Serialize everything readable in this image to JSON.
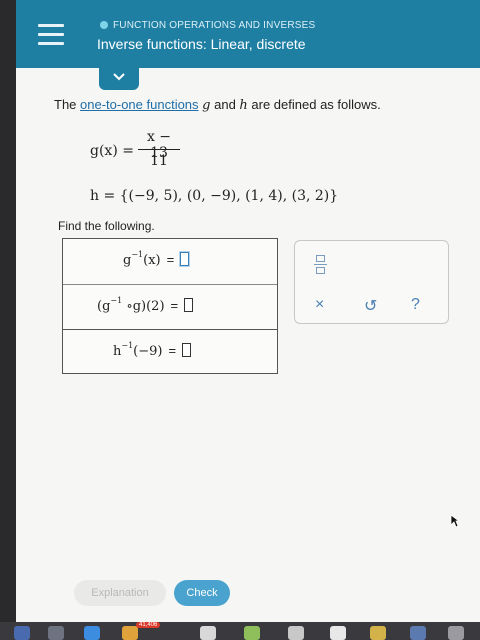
{
  "header": {
    "topic": "FUNCTION OPERATIONS AND INVERSES",
    "title": "Inverse functions: Linear, discrete"
  },
  "prompt": {
    "before": "The ",
    "link": "one-to-one functions",
    "var_g": "g",
    "middle": " and ",
    "var_h": "h",
    "after": " are defined as follows."
  },
  "g_def": {
    "lhs": "g(x) =",
    "numerator": "x − 13",
    "denominator": "11"
  },
  "h_def": "h = {(−9, 5), (0, −9), (1, 4), (3, 2)}",
  "find_label": "Find the following.",
  "answers": [
    {
      "fn": "g",
      "sup": "−1",
      "arg": "(x)",
      "eq": "="
    },
    {
      "open": "(g",
      "sup": "−1",
      "rest": " ∘g)(2)",
      "eq": "="
    },
    {
      "fn": "h",
      "sup": "−1",
      "arg": "(−9)",
      "eq": "="
    }
  ],
  "tools": {
    "clear": "×",
    "undo": "↺",
    "help": "?"
  },
  "buttons": {
    "explanation": "Explanation",
    "check": "Check"
  },
  "dock": {
    "badge": "41,406"
  },
  "colors": {
    "header": "#1f7fa3",
    "link": "#1f6ea8",
    "check": "#4aa3cf",
    "tool_icons": "#4a7fb3"
  }
}
